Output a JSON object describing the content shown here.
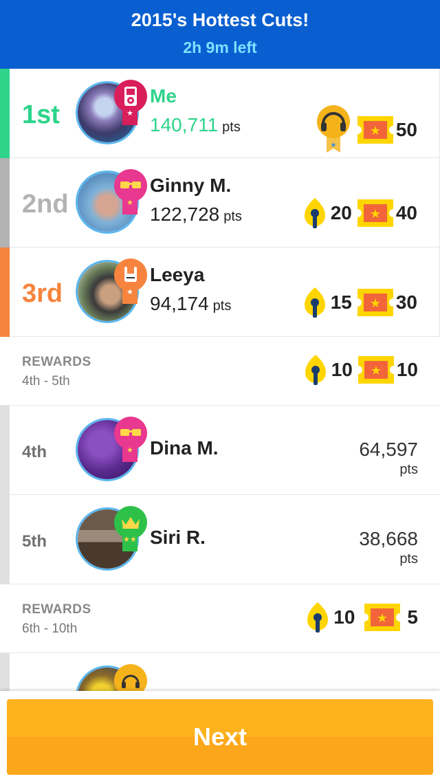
{
  "header": {
    "title": "2015's Hottest Cuts!",
    "time_left": "2h 9m left"
  },
  "colors": {
    "first": "#2ed48a",
    "second": "#b3b3b3",
    "third": "#f6843e",
    "header_bg": "#0a5fd0",
    "next_button": "#fdb21d"
  },
  "rows": [
    {
      "rank": "1st",
      "name": "Me",
      "points": "140,711",
      "pts_label": "pts",
      "badge": "ipod-badge-icon",
      "reward_icon": "headphones-trophy-icon",
      "tickets": "50"
    },
    {
      "rank": "2nd",
      "name": "Ginny M.",
      "points": "122,728",
      "pts_label": "pts",
      "badge": "shades-badge-icon",
      "mics": "20",
      "tickets": "40"
    },
    {
      "rank": "3rd",
      "name": "Leeya",
      "points": "94,174",
      "pts_label": "pts",
      "badge": "rock-hand-badge-icon",
      "mics": "15",
      "tickets": "30"
    },
    {
      "rank": "4th",
      "name": "Dina M.",
      "points": "64,597",
      "pts_label": "pts",
      "badge": "shades-badge-icon"
    },
    {
      "rank": "5th",
      "name": "Siri R.",
      "points": "38,668",
      "pts_label": "pts",
      "badge": "crown-badge-icon"
    }
  ],
  "rewards": [
    {
      "label": "REWARDS",
      "range": "4th - 5th",
      "mics": "10",
      "tickets": "10"
    },
    {
      "label": "REWARDS",
      "range": "6th - 10th",
      "mics": "10",
      "tickets": "5"
    }
  ],
  "footer": {
    "next_label": "Next"
  }
}
